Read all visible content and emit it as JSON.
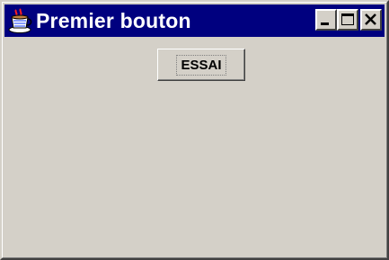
{
  "window": {
    "title": "Premier bouton",
    "icon": "java-coffee-cup-icon",
    "controls": {
      "minimize": "minimize-icon",
      "maximize": "maximize-icon",
      "close": "close-icon"
    }
  },
  "content": {
    "button_label": "ESSAI"
  },
  "colors": {
    "titlebar": "#00007f",
    "face": "#d4d0c8"
  }
}
